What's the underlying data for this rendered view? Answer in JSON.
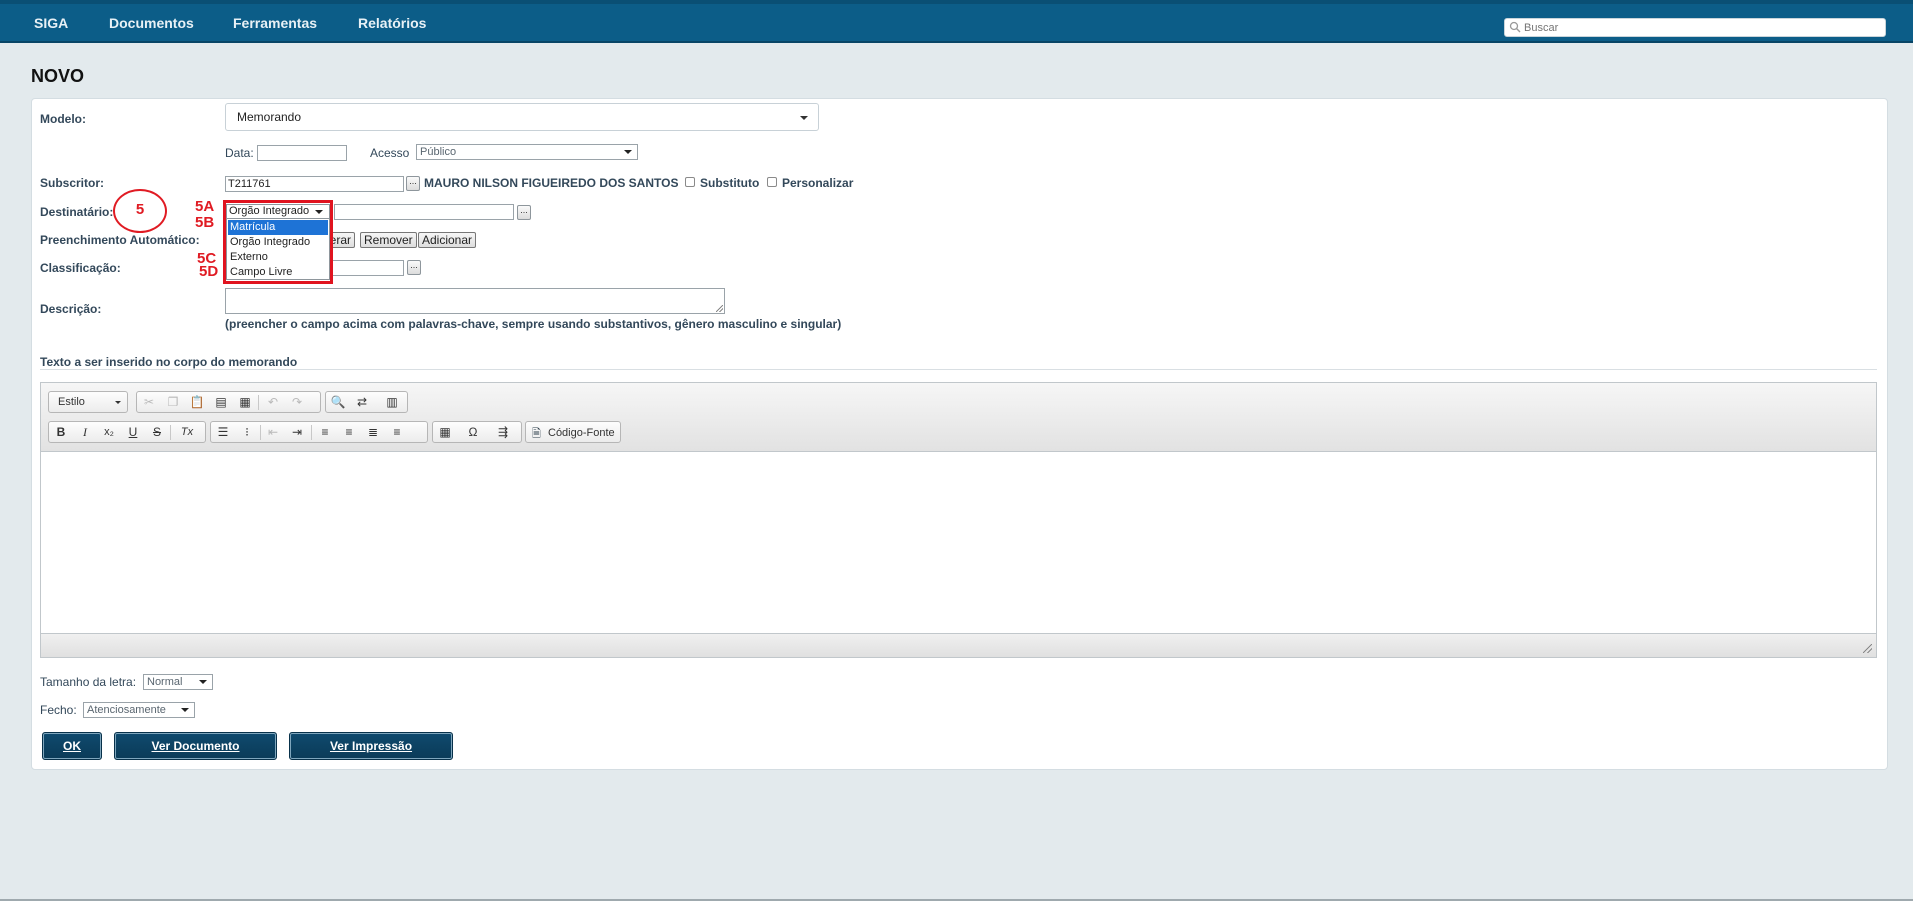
{
  "nav": {
    "items": [
      "SIGA",
      "Documentos",
      "Ferramentas",
      "Relatórios"
    ],
    "search_placeholder": "Buscar"
  },
  "page": {
    "title": "NOVO"
  },
  "form": {
    "modelo_label": "Modelo:",
    "modelo_value": "Memorando",
    "data_label": "Data:",
    "data_value": "",
    "acesso_label": "Acesso",
    "acesso_value": "Público",
    "subscritor_label": "Subscritor:",
    "subscritor_value": "T211761",
    "subscritor_name": "MAURO NILSON FIGUEIREDO DOS SANTOS",
    "substituto_label": "Substituto",
    "personalizar_label": "Personalizar",
    "destinatario_label": "Destinatário:",
    "destinatario_type": "Orgão Integrado",
    "destinatario_options": [
      "Matrícula",
      "Orgão Integrado",
      "Externo",
      "Campo Livre"
    ],
    "destinatario_selected_option": "Matrícula",
    "preenchimento_label": "Preenchimento Automático:",
    "alterar_label": "Alterar",
    "remover_label": "Remover",
    "adicionar_label": "Adicionar",
    "classificacao_label": "Classificação:",
    "descricao_label": "Descrição:",
    "descricao_hint": "(preencher o campo acima com palavras-chave, sempre usando substantivos, gênero masculino e singular)",
    "dots": "..."
  },
  "editor": {
    "section_title": "Texto a ser inserido no corpo do memorando",
    "estilo_label": "Estilo",
    "source_label": "Código-Fonte",
    "buttons_row2": [
      "B",
      "I",
      "x₂",
      "U",
      "S",
      "Tx"
    ]
  },
  "footer_form": {
    "tamanho_label": "Tamanho da letra:",
    "tamanho_value": "Normal",
    "fecho_label": "Fecho:",
    "fecho_value": "Atenciosamente",
    "ok_label": "OK",
    "ver_documento_label": "Ver Documento",
    "ver_impressao_label": "Ver Impressão"
  },
  "annotations": {
    "circle": "5",
    "labels": [
      "5A",
      "5B",
      "5C",
      "5D"
    ],
    "color": "#e01b23"
  }
}
